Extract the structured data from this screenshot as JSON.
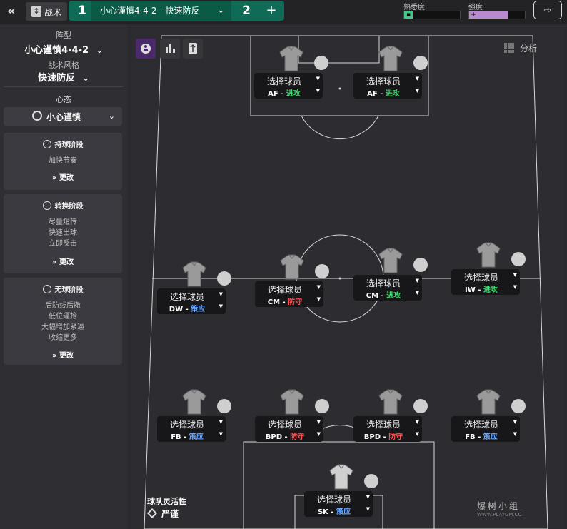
{
  "topbar": {
    "back_icon": "double-chevron-left-icon",
    "tactics_label": "战术",
    "tactic1_num": "1",
    "tactic_name": "小心谨慎4-4-2 - 快速防反",
    "tactic2_num": "2",
    "add_label": "+",
    "familiarity_label": "熟悉度",
    "intensity_label": "强度",
    "familiarity_level": 0.16,
    "intensity_level": 0.7,
    "familiarity_color": "#3ecb8a",
    "intensity_color": "#b98ad0"
  },
  "sidebar": {
    "formation_label": "阵型",
    "formation_value": "小心谨慎4-4-2",
    "style_label": "战术风格",
    "style_value": "快速防反",
    "mentality_label": "心态",
    "mentality_value": "小心谨慎",
    "phases": [
      {
        "title": "持球阶段",
        "items": [
          "加快节奏"
        ],
        "change": "更改"
      },
      {
        "title": "转换阶段",
        "items": [
          "尽量短传",
          "快速出球",
          "立即反击"
        ],
        "change": "更改"
      },
      {
        "title": "无球阶段",
        "items": [
          "后防线后撤",
          "低位逼抢",
          "大幅增加紧逼",
          "收缩更多"
        ],
        "change": "更改"
      }
    ]
  },
  "pitch": {
    "analysis_label": "分析",
    "flex_label": "球队灵活性",
    "flex_value": "严谨",
    "players": [
      {
        "name": "选择球员",
        "role": "AF",
        "duty": "进攻",
        "duty_type": "attack"
      },
      {
        "name": "选择球员",
        "role": "AF",
        "duty": "进攻",
        "duty_type": "attack"
      },
      {
        "name": "选择球员",
        "role": "DW",
        "duty": "策应",
        "duty_type": "support"
      },
      {
        "name": "选择球员",
        "role": "CM",
        "duty": "防守",
        "duty_type": "defend"
      },
      {
        "name": "选择球员",
        "role": "CM",
        "duty": "进攻",
        "duty_type": "attack"
      },
      {
        "name": "选择球员",
        "role": "IW",
        "duty": "进攻",
        "duty_type": "attack"
      },
      {
        "name": "选择球员",
        "role": "FB",
        "duty": "策应",
        "duty_type": "support"
      },
      {
        "name": "选择球员",
        "role": "BPD",
        "duty": "防守",
        "duty_type": "defend"
      },
      {
        "name": "选择球员",
        "role": "BPD",
        "duty": "防守",
        "duty_type": "defend"
      },
      {
        "name": "选择球员",
        "role": "FB",
        "duty": "策应",
        "duty_type": "support"
      },
      {
        "name": "选择球员",
        "role": "SK",
        "duty": "策应",
        "duty_type": "support"
      }
    ]
  },
  "watermark": {
    "main": "爆树小组",
    "sub": "WWW.PLAYGM.CC"
  }
}
